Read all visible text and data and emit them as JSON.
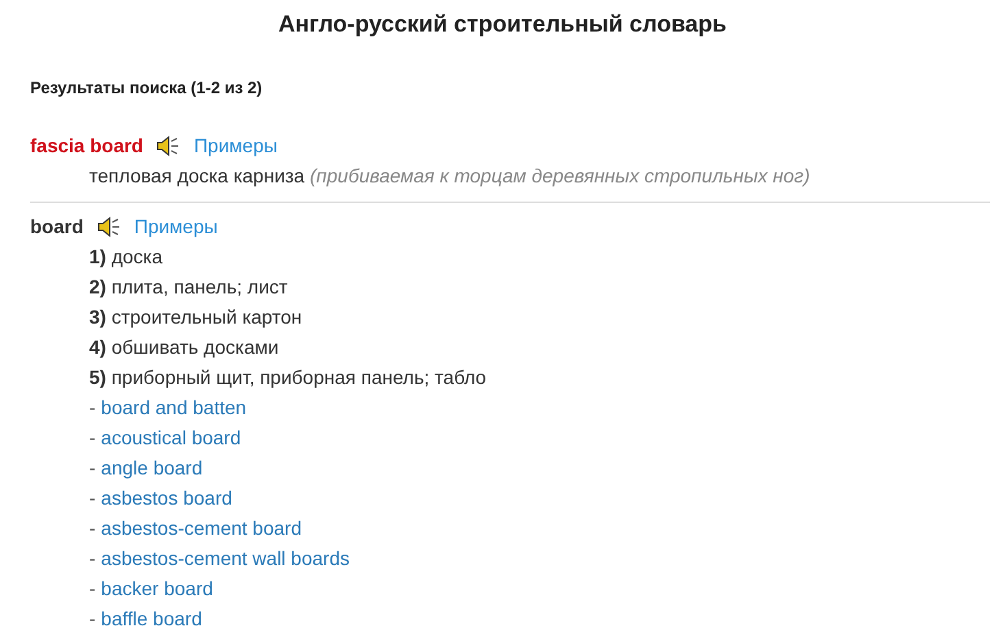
{
  "title": "Англо-русский строительный словарь",
  "results_label": "Результаты поиска (1-2 из 2)",
  "entries": [
    {
      "term": "fascia board",
      "highlighted": true,
      "examples_link": "Примеры",
      "translation": "тепловая доска карниза *(прибиваемая к торцам деревянных стропильных ног)*"
    },
    {
      "term": "board",
      "highlighted": false,
      "examples_link": "Примеры",
      "senses": [
        "**1)** доска",
        "**2)** плита, панель; лист",
        "**3)** строительный картон",
        "**4)** обшивать досками",
        "**5)** приборный щит, приборная панель; табло"
      ],
      "related": [
        {
          "prefix": "-",
          "term": "board and batten"
        },
        {
          "prefix": "-",
          "term": "acoustical board"
        },
        {
          "prefix": "-",
          "term": "angle board"
        },
        {
          "prefix": "-",
          "term": "asbestos board"
        },
        {
          "prefix": "-",
          "term": "asbestos-cement board"
        },
        {
          "prefix": "-",
          "term": "asbestos-cement wall boards"
        },
        {
          "prefix": "-",
          "term": "backer board"
        },
        {
          "prefix": "-",
          "term": "baffle board"
        }
      ]
    }
  ]
}
